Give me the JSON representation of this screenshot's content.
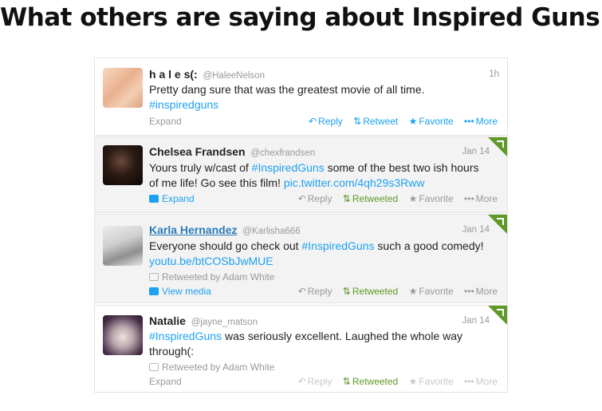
{
  "headline": "What others are saying about Inspired Guns:",
  "tweets": [
    {
      "name": "h a l e s(:",
      "handle": "@HaleeNelson",
      "time": "1h",
      "text_1": "Pretty dang sure that was the greatest movie of all time.",
      "hashtag": "#inspiredguns",
      "expand": "Expand",
      "actions": {
        "reply": "Reply",
        "retweet": "Retweet",
        "favorite": "Favorite",
        "more": "More"
      }
    },
    {
      "name": "Chelsea Frandsen",
      "handle": "@chexfrandsen",
      "time": "Jan 14",
      "text_1": "Yours truly w/cast of ",
      "hashtag": "#InspiredGuns",
      "text_2": " some of the best two ish hours",
      "text_3": "of me life! Go see this film! ",
      "url": "pic.twitter.com/4qh29s3Rww",
      "expand": "Expand",
      "actions": {
        "reply": "Reply",
        "retweet": "Retweeted",
        "favorite": "Favorite",
        "more": "More"
      }
    },
    {
      "name": "Karla Hernandez",
      "handle": "@Karlisha666",
      "time": "Jan 14",
      "text_1": "Everyone should go check out ",
      "hashtag": "#InspiredGuns",
      "text_2": " such a good comedy!",
      "url": "youtu.be/btCOSbJwMUE",
      "retweeted_by": "Retweeted by Adam White",
      "view_media": "View media",
      "actions": {
        "reply": "Reply",
        "retweet": "Retweeted",
        "favorite": "Favorite",
        "more": "More"
      }
    },
    {
      "name": "Natalie",
      "handle": "@jayne_matson",
      "time": "Jan 14",
      "hashtag": "#InspiredGuns",
      "text_1": " was seriously excellent. Laughed the whole way",
      "text_2": "through(:",
      "retweeted_by": "Retweeted by Adam White",
      "expand": "Expand",
      "actions": {
        "reply": "Reply",
        "retweet": "Retweeted",
        "favorite": "Favorite",
        "more": "More"
      }
    }
  ],
  "colors": {
    "link": "#1da1f2",
    "retweeted": "#609928",
    "corner": "#609928"
  }
}
